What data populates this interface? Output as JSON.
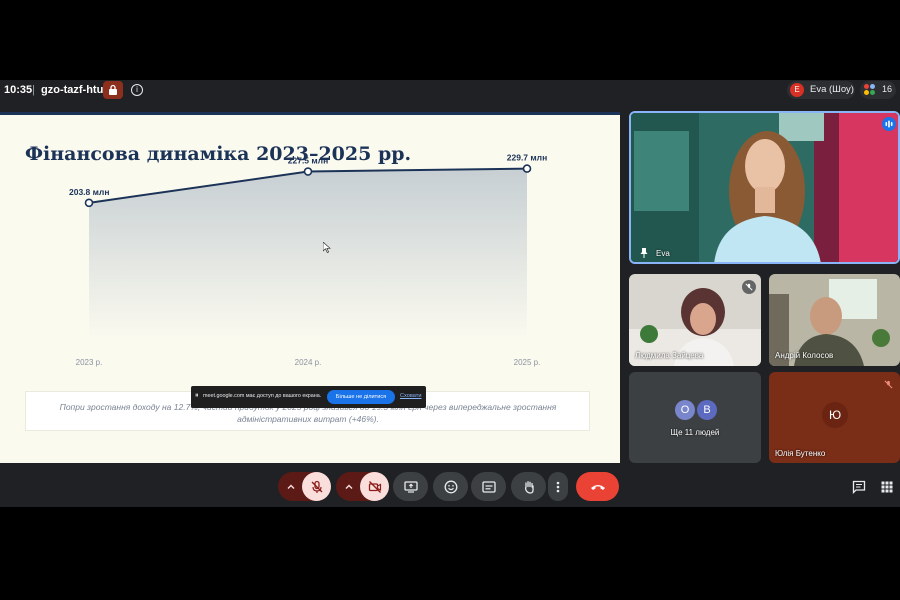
{
  "topbar": {
    "time": "10:35",
    "separator": "|",
    "meeting_code": "gzo-tazf-htu",
    "info_glyph": "i",
    "presenter_initial": "E",
    "presenter_label": "Eva (Шоу)",
    "participant_count": "16"
  },
  "slide": {
    "title": "Фінансова динаміка 2023–2025 рр.",
    "caption": "Попри зростання доходу на 12.7%, чистий прибуток у 2025 році знизився до 19.3 млн грн через випереджальне зростання адміністративних витрат (+46%).",
    "accent_color": "#1c3358"
  },
  "chart_data": {
    "type": "area",
    "categories": [
      "2023 р.",
      "2024 р.",
      "2025 р."
    ],
    "values": [
      203.8,
      227.5,
      229.7
    ],
    "data_labels": [
      "203.8 млн",
      "227.5 млн",
      "229.7 млн"
    ],
    "title": "Фінансова динаміка 2023–2025 рр.",
    "ylim": [
      100,
      240
    ],
    "grid": false,
    "legend": "none"
  },
  "toast": {
    "glyph": "⏸",
    "message": "meet.google.com має доступ до вашого екрана.",
    "stop_button": "Більше не ділитися",
    "hide_link": "Сховати"
  },
  "tiles": {
    "main_speaker_name": "Eva",
    "p1_name": "Людмила Зайцева",
    "p2_name": "Андрій Колосов",
    "others_initials": [
      "О",
      "В"
    ],
    "others_label": "Ще 11 людей",
    "p3_initial": "Ю",
    "p3_name": "Юлія Бутенко"
  },
  "colors": {
    "end_call": "#ea4335",
    "mic_off_bg": "#f9dedc",
    "mic_off_icon": "#8c1d18",
    "active_speaker_border": "#8ab4f8"
  }
}
